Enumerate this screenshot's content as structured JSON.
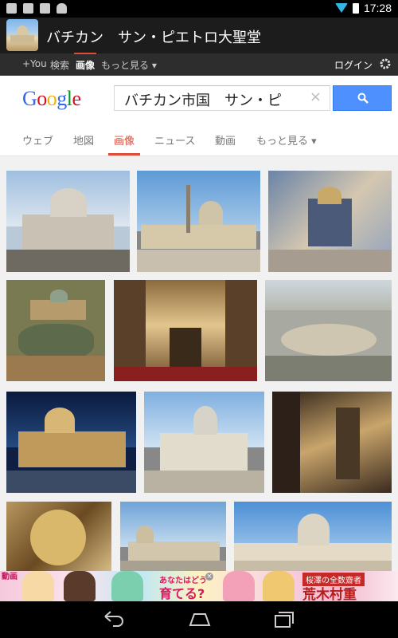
{
  "status_bar": {
    "time": "17:28",
    "icons": [
      "notification-icon",
      "bag-icon",
      "download-icon",
      "android-icon"
    ]
  },
  "app_bar": {
    "title": "バチカン　サン・ピエトロ大聖堂"
  },
  "google_nav": {
    "items": [
      "+You",
      "検索",
      "画像",
      "もっと見る ▾"
    ],
    "active_index": 2,
    "login_label": "ログイン"
  },
  "search": {
    "logo_letters": [
      "G",
      "o",
      "o",
      "g",
      "l",
      "e"
    ],
    "query": "バチカン市国　サン・ピ",
    "clear_label": "×"
  },
  "tabs": {
    "items": [
      "ウェブ",
      "地図",
      "画像",
      "ニュース",
      "動画",
      "もっと見る ▾"
    ],
    "active_index": 2
  },
  "ad": {
    "left_text": "動画",
    "mid_top": "あなたはどう",
    "mid_main": "育てる?",
    "close_label": "×",
    "right_top": "桜澤の全数齋者",
    "right_main": "荒木村重"
  },
  "colors": {
    "accent": "#dd4b39",
    "search_button": "#4d90fe",
    "wifi": "#33b5e5"
  }
}
